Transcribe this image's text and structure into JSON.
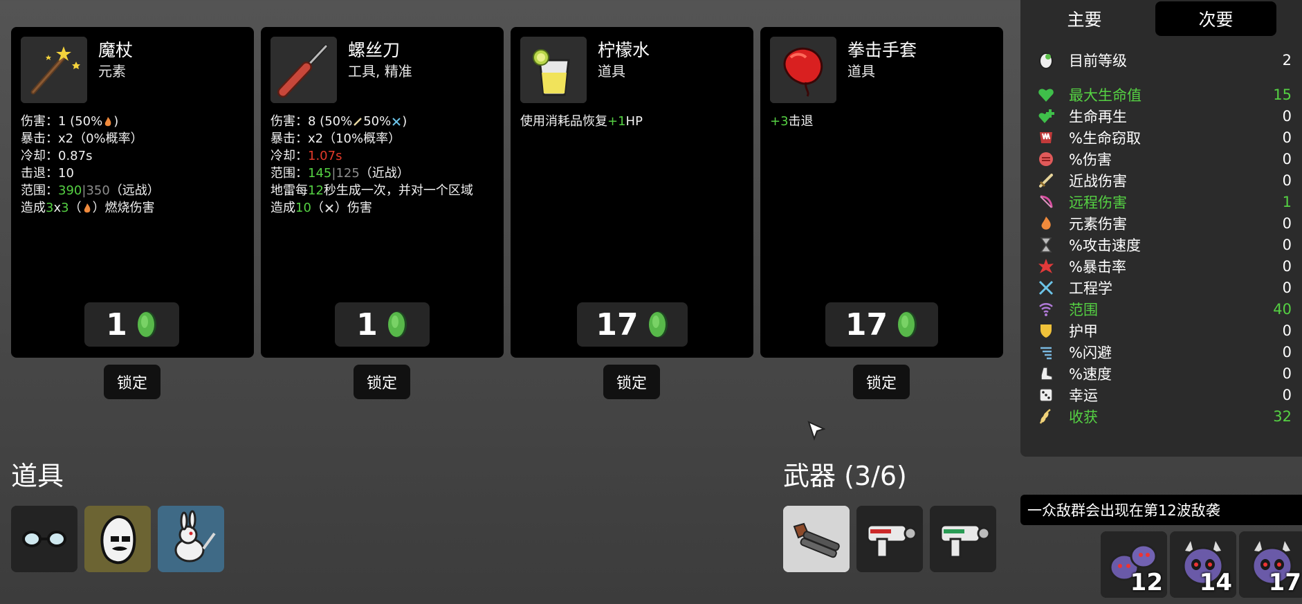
{
  "shop": {
    "items": [
      {
        "name": "魔杖",
        "type": "元素",
        "icon": "wand-icon",
        "stat_lines": {
          "damage_prefix": "伤害：1 (50%",
          "damage_suffix": ")",
          "crit": "暴击：x2（0%概率）",
          "cooldown": "冷却：0.87s",
          "knockback": "击退：10",
          "range_prefix": "范围：",
          "range_value": "390",
          "range_sep": " | ",
          "range_base": "350",
          "range_suffix": "（远战）",
          "effect_prefix": "造成",
          "effect_a": "3",
          "effect_x": "x",
          "effect_b": "3",
          "effect_mid": "（",
          "effect_suffix": "）燃烧伤害"
        },
        "price": "1",
        "lock_label": "锁定"
      },
      {
        "name": "螺丝刀",
        "type": "工具, 精准",
        "icon": "screwdriver-icon",
        "stat_lines": {
          "damage_prefix": "伤害：8 (50%",
          "damage_mid": "50%",
          "damage_suffix": ")",
          "crit": "暴击：x2（10%概率）",
          "cooldown_prefix": "冷却：",
          "cooldown_value": "1.07s",
          "range_prefix": "范围：",
          "range_value": "145",
          "range_sep": " | ",
          "range_base": "125",
          "range_suffix": "（近战）",
          "effect_prefix": "地雷每",
          "effect_num": "12",
          "effect_rest": "秒生成一次，并对一个区域",
          "effect2_prefix": "造成",
          "effect2_num": "10",
          "effect2_mid": "（",
          "effect2_suffix": "）伤害"
        },
        "price": "1",
        "lock_label": "锁定"
      },
      {
        "name": "柠檬水",
        "type": "道具",
        "icon": "lemonade-icon",
        "stat_lines": {
          "effect_prefix": "使用消耗品恢复",
          "effect_value": "+1",
          "effect_suffix": "HP"
        },
        "price": "17",
        "lock_label": "锁定"
      },
      {
        "name": "拳击手套",
        "type": "道具",
        "icon": "boxing-glove-icon",
        "stat_lines": {
          "effect_value": "+3",
          "effect_suffix": "击退"
        },
        "price": "17",
        "lock_label": "锁定"
      }
    ]
  },
  "inventory": {
    "items_title": "道具",
    "items": [
      {
        "icon": "glasses-icon"
      },
      {
        "icon": "potato-mustache-icon"
      },
      {
        "icon": "rabbit-icon"
      }
    ],
    "weapons_title": "武器 (3/6)",
    "weapons": [
      {
        "icon": "shotgun-icon",
        "selected": true
      },
      {
        "icon": "laser-gun-icon",
        "selected": false
      },
      {
        "icon": "laser-gun-icon",
        "selected": false
      }
    ]
  },
  "stats_panel": {
    "tab_primary": "主要",
    "tab_secondary": "次要",
    "active_tab": "次要",
    "level_label": "目前等级",
    "level_value": "2",
    "rows": [
      {
        "label": "最大生命值",
        "value": "15",
        "highlight": "green",
        "icon": "heart-icon"
      },
      {
        "label": "生命再生",
        "value": "0",
        "highlight": "none",
        "icon": "regen-icon"
      },
      {
        "label": "%生命窃取",
        "value": "0",
        "highlight": "none",
        "icon": "lifesteal-icon"
      },
      {
        "label": "%伤害",
        "value": "0",
        "highlight": "none",
        "icon": "fist-icon"
      },
      {
        "label": "近战伤害",
        "value": "0",
        "highlight": "none",
        "icon": "sword-icon"
      },
      {
        "label": "远程伤害",
        "value": "1",
        "highlight": "green",
        "icon": "bow-icon"
      },
      {
        "label": "元素伤害",
        "value": "0",
        "highlight": "none",
        "icon": "flame-icon"
      },
      {
        "label": "%攻击速度",
        "value": "0",
        "highlight": "none",
        "icon": "hourglass-icon"
      },
      {
        "label": "%暴击率",
        "value": "0",
        "highlight": "none",
        "icon": "crit-icon"
      },
      {
        "label": "工程学",
        "value": "0",
        "highlight": "none",
        "icon": "wrench-icon"
      },
      {
        "label": "范围",
        "value": "40",
        "highlight": "green",
        "icon": "range-icon"
      },
      {
        "label": "护甲",
        "value": "0",
        "highlight": "none",
        "icon": "shield-icon"
      },
      {
        "label": "%闪避",
        "value": "0",
        "highlight": "none",
        "icon": "dodge-icon"
      },
      {
        "label": "%速度",
        "value": "0",
        "highlight": "none",
        "icon": "boot-icon"
      },
      {
        "label": "幸运",
        "value": "0",
        "highlight": "none",
        "icon": "dice-icon"
      },
      {
        "label": "收获",
        "value": "32",
        "highlight": "green",
        "icon": "harvest-icon"
      }
    ]
  },
  "wave": {
    "banner": "一众敌群会出现在第12波敌袭",
    "enemies": [
      {
        "icon": "blob-enemy-icon",
        "count": "12"
      },
      {
        "icon": "horned-enemy-icon",
        "count": "14"
      },
      {
        "icon": "horned-enemy-icon",
        "count": "17"
      }
    ]
  },
  "colors": {
    "green": "#55d143",
    "red": "#e43a2a",
    "gray": "#8d8d8d"
  }
}
